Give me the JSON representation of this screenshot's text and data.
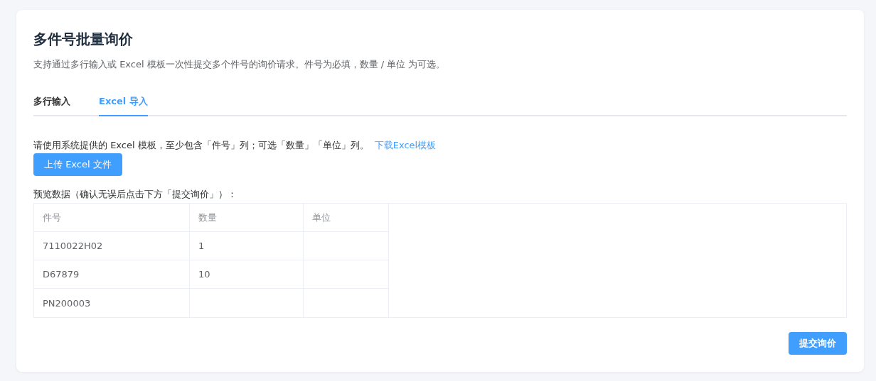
{
  "title": "多件号批量询价",
  "description": "支持通过多行输入或 Excel 模板一次性提交多个件号的询价请求。件号为必填，数量 / 单位 为可选。",
  "tabs": [
    {
      "label": "多行输入",
      "selected": false
    },
    {
      "label": "Excel 导入",
      "selected": true
    }
  ],
  "instruction": "请使用系统提供的 Excel 模板，至少包含「件号」列；可选「数量」「单位」列。",
  "template_link": "下载Excel模板",
  "upload_button": "上传 Excel 文件",
  "preview_label": "预览数据（确认无误后点击下方「提交询价」）：",
  "table": {
    "columns": [
      "件号",
      "数量",
      "单位"
    ],
    "rows": [
      {
        "part_no": "7110022H02",
        "quantity": "1"
      },
      {
        "part_no": "D67879",
        "quantity": "10"
      },
      {
        "part_no": "PN200003"
      }
    ]
  },
  "submit_button": "提交询价"
}
